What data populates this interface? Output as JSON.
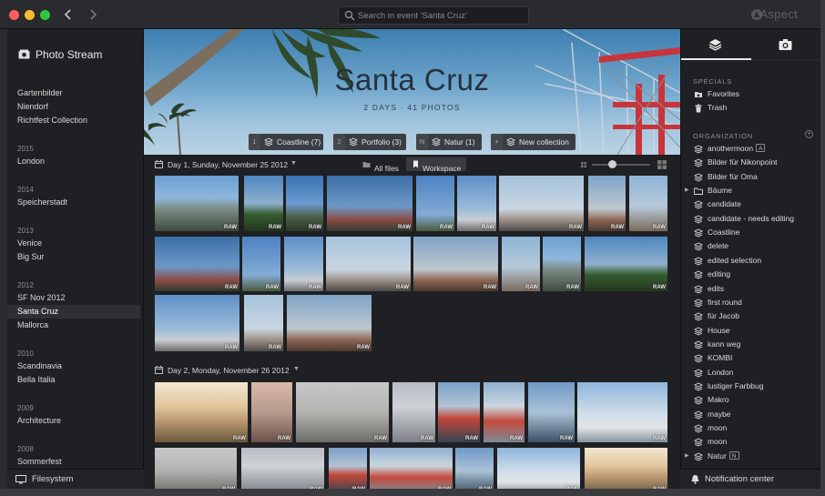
{
  "titlebar": {
    "search_placeholder": "Search in event 'Santa Cruz'",
    "brand": "Aspect"
  },
  "left_sidebar": {
    "header": "Photo Stream",
    "footer": "Filesystem",
    "groups": [
      {
        "year": "",
        "items": [
          "Gartenbilder",
          "Niendorf",
          "Richtfest Collection"
        ]
      },
      {
        "year": "2015",
        "items": [
          "London"
        ]
      },
      {
        "year": "2014",
        "items": [
          "Speicherstadt"
        ]
      },
      {
        "year": "2013",
        "items": [
          "Venice",
          "Big Sur"
        ]
      },
      {
        "year": "2012",
        "items": [
          "SF Nov 2012",
          "Santa Cruz",
          "Mallorca"
        ]
      },
      {
        "year": "2010",
        "items": [
          "Scandinavia",
          "Bella Italia"
        ]
      },
      {
        "year": "2009",
        "items": [
          "Architecture"
        ]
      },
      {
        "year": "2008",
        "items": [
          "Sommerfest"
        ]
      }
    ],
    "active_item": "Santa Cruz"
  },
  "event": {
    "title": "Santa Cruz",
    "subtitle": "2 DAYS · 41 PHOTOS",
    "collections": [
      {
        "key": "1",
        "label": "Coastline (7)"
      },
      {
        "key": "2",
        "label": "Portfolio (3)"
      },
      {
        "key": "N",
        "label": "Natur (1)"
      },
      {
        "key": "+",
        "label": "New collection"
      }
    ]
  },
  "view": {
    "all_files": "All files",
    "workspace": "Workspace",
    "zoom_level": 0.35
  },
  "days": [
    {
      "title": "Day 1, Sunday, November 25 2012"
    },
    {
      "title": "Day 2, Monday, November 26 2012"
    }
  ],
  "raw_label": "RAW",
  "right_sidebar": {
    "specials_header": "SPECIALS",
    "specials": [
      {
        "label": "Favorites",
        "icon": "favorites-icon"
      },
      {
        "label": "Trash",
        "icon": "trash-icon"
      }
    ],
    "organization_header": "ORGANIZATION",
    "organization": [
      {
        "label": "anothermoon",
        "badge": "A"
      },
      {
        "label": "Bilder für Nikonpoint",
        "badge": ""
      },
      {
        "label": "Bilder für Oma",
        "badge": ""
      },
      {
        "label": "Bäume",
        "badge": "",
        "folder": true
      },
      {
        "label": "candidate",
        "badge": ""
      },
      {
        "label": "candidate - needs editing",
        "badge": ""
      },
      {
        "label": "Coastline",
        "badge": ""
      },
      {
        "label": "delete",
        "badge": ""
      },
      {
        "label": "edited selection",
        "badge": ""
      },
      {
        "label": "editing",
        "badge": ""
      },
      {
        "label": "edits",
        "badge": ""
      },
      {
        "label": "first round",
        "badge": ""
      },
      {
        "label": "für Jacob",
        "badge": ""
      },
      {
        "label": "House",
        "badge": ""
      },
      {
        "label": "kann weg",
        "badge": ""
      },
      {
        "label": "KOMBI",
        "badge": ""
      },
      {
        "label": "London",
        "badge": ""
      },
      {
        "label": "lustiger Farbbug",
        "badge": ""
      },
      {
        "label": "Makro",
        "badge": ""
      },
      {
        "label": "maybe",
        "badge": ""
      },
      {
        "label": "moon",
        "badge": ""
      },
      {
        "label": "moon",
        "badge": ""
      },
      {
        "label": "Natur",
        "badge": "N",
        "expandable": true
      }
    ],
    "footer": "Notification center"
  }
}
